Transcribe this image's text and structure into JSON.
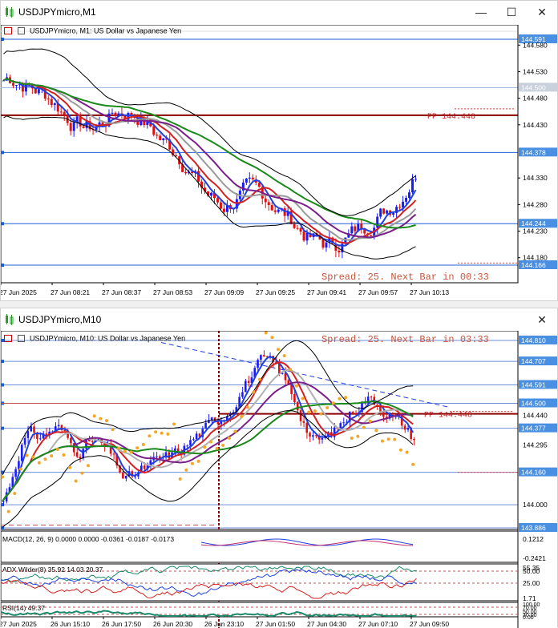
{
  "window1": {
    "title": "USDJPYmicro,M1",
    "chart_caption": "USDJPYmicro, M1:  US Dollar vs Japanese Yen",
    "price_labels": [
      "144.591",
      "144.580",
      "144.530",
      "144.500",
      "144.480",
      "144.430",
      "144.378",
      "144.330",
      "144.280",
      "144.244",
      "144.230",
      "144.180",
      "144.166"
    ],
    "pp_label": "PP 144.448",
    "spread_text": "Spread: 25. Next Bar in 00:33",
    "time_labels": [
      "27 Jun 2025",
      "27 Jun 08:21",
      "27 Jun 08:37",
      "27 Jun 08:53",
      "27 Jun 09:09",
      "27 Jun 09:25",
      "27 Jun 09:41",
      "27 Jun 09:57",
      "27 Jun 10:13"
    ]
  },
  "window2": {
    "title": "USDJPYmicro,M10",
    "chart_caption": "USDJPYmicro, M10:  US Dollar vs Japanese Yen",
    "price_labels": [
      "144.810",
      "144.707",
      "144.591",
      "144.500",
      "144.440",
      "144.377",
      "144.295",
      "144.160",
      "144.000",
      "143.886"
    ],
    "pp_label": "PP 144.448",
    "spread_text": "Spread: 25. Next Bar in 03:33",
    "macd_label": "MACD(12, 26, 9) 0.0000 0.0000 -0.0361 -0.0187 -0.0173",
    "macd_scale": [
      "0.1212",
      "-0.2421"
    ],
    "adx_label": "ADX Wilder(8) 35.92 14.03 20.37",
    "adx_scale": [
      "55.35",
      "50.00",
      "25.00",
      "1.71"
    ],
    "rsi_label": "RSI(14) 49.37",
    "rsi_scale": [
      "100.00",
      "70.00",
      "50.00",
      "30.00",
      "0.00"
    ],
    "time_labels": [
      "27 Jun 2025",
      "26 Jun 15:10",
      "26 Jun 17:50",
      "26 Jun 20:30",
      "26 Jun 23:10",
      "27 Jun 01:50",
      "27 Jun 04:30",
      "27 Jun 07:10",
      "27 Jun 09:50"
    ]
  },
  "colors": {
    "bull": "#1a1aff",
    "bear": "#e01010",
    "pp_line": "#8b0000",
    "hline": "#1f5fd6",
    "label_bg": "#4a90e2",
    "spread_text": "#c8553d"
  }
}
